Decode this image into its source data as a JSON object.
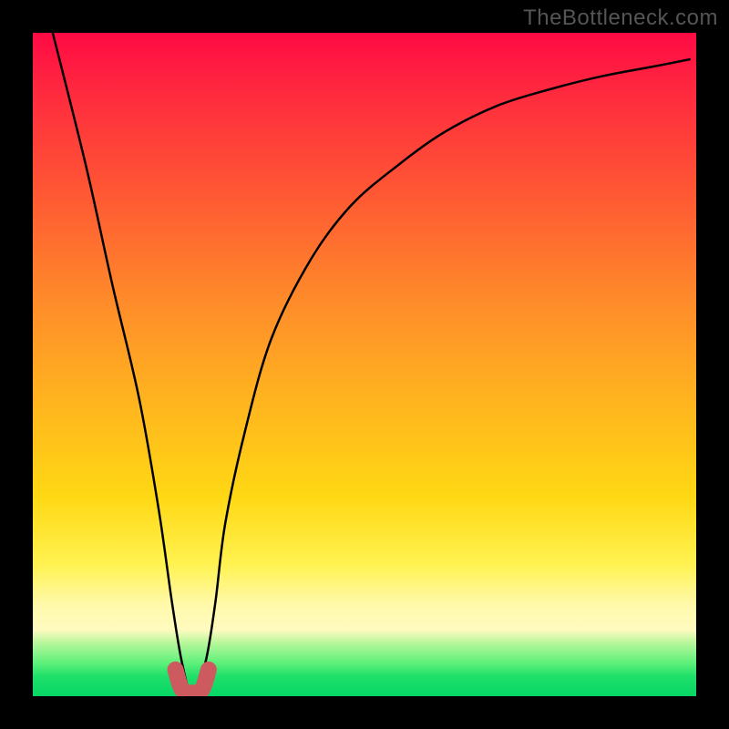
{
  "branding": {
    "text": "TheBottleneck.com"
  },
  "chart_data": {
    "type": "line",
    "title": "",
    "xlabel": "",
    "ylabel": "",
    "xlim": [
      0,
      100
    ],
    "ylim": [
      0,
      100
    ],
    "grid": false,
    "legend": false,
    "background_gradient": {
      "stops": [
        {
          "pos": 0,
          "color": "#ff0a44"
        },
        {
          "pos": 25,
          "color": "#ff5a33"
        },
        {
          "pos": 55,
          "color": "#ffb31f"
        },
        {
          "pos": 80,
          "color": "#fff250"
        },
        {
          "pos": 90,
          "color": "#fffbc0"
        },
        {
          "pos": 100,
          "color": "#06d666"
        }
      ]
    },
    "series": [
      {
        "name": "curve",
        "color": "#000000",
        "x": [
          3,
          8,
          12,
          16,
          19,
          21,
          22.5,
          24,
          26,
          27.5,
          29,
          32,
          36,
          42,
          48,
          55,
          62,
          70,
          78,
          86,
          94,
          99
        ],
        "y": [
          100,
          80,
          62,
          45,
          28,
          14,
          5,
          0.5,
          5,
          14,
          26,
          40,
          54,
          66,
          74,
          80,
          85,
          89,
          91.5,
          93.5,
          95,
          96
        ]
      },
      {
        "name": "minimum-marker",
        "color": "#cc5a5f",
        "type": "scatter",
        "x": [
          21.5,
          22.5,
          24,
          25.5,
          26.5
        ],
        "y": [
          4,
          1,
          0.5,
          1,
          4
        ]
      }
    ],
    "annotations": []
  }
}
